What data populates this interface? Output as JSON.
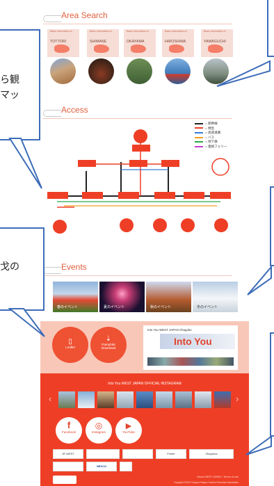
{
  "area_search": {
    "title": "Area Search",
    "cards": [
      {
        "caption": "Basic information of",
        "pref": "TOTTORI"
      },
      {
        "caption": "Basic information of",
        "pref": "SHIMANE"
      },
      {
        "caption": "Basic information of",
        "pref": "OKAYAMA"
      },
      {
        "caption": "Basic information of",
        "pref": "HIROSHIMA"
      },
      {
        "caption": "Basic information of",
        "pref": "YAMAGUCHI"
      }
    ]
  },
  "callouts": {
    "left_top": [
      "ら観",
      "マッ"
    ],
    "left_mid": "戈の"
  },
  "access": {
    "title": "Access",
    "legend": [
      "= 新幹線",
      "= 特急",
      "= 高速道路",
      "= バス",
      "= 地下鉄",
      "= 連絡フェリー"
    ],
    "nodes": [
      "国際空港",
      "大阪",
      "鳥取",
      "米子",
      "岡山",
      "広島",
      "山口"
    ],
    "times": [
      "45分",
      "27分",
      "212分",
      "177分",
      "32分",
      "152分",
      "26分"
    ]
  },
  "events": {
    "title": "Events",
    "items": [
      {
        "label": "春のイベント"
      },
      {
        "label": "夏のイベント"
      },
      {
        "label": "秋のイベント"
      },
      {
        "label": "冬のイベント"
      }
    ]
  },
  "links": {
    "leaflet": "Leaflet",
    "pamphlet": [
      "Pamphlet",
      "Download"
    ],
    "into_you": {
      "title": "Into You",
      "sub": "Into You WEST JAPAN Chugoku"
    }
  },
  "instagram": {
    "title": "Into You WEST JAPAN OFFICIAL INSTAGRAM",
    "prev": "‹",
    "next": "›"
  },
  "social": [
    {
      "letter": "f",
      "label": "Facebook"
    },
    {
      "letter": "◎",
      "label": "Instagram"
    },
    {
      "letter": "▶",
      "label": "YouTube"
    }
  ],
  "banners": [
    "JR WEST",
    "NEXCO",
    "Finder",
    "Okayama"
  ],
  "footer": {
    "links": "About WEST JAPAN / Terms of use",
    "copyright": "Copyright ©2020 Chugoku Region Tourism Promotion Association"
  },
  "colors": {
    "accent": "#ee3f26",
    "callout_border": "#3d6cb8",
    "pink": "#f9c7b8"
  }
}
